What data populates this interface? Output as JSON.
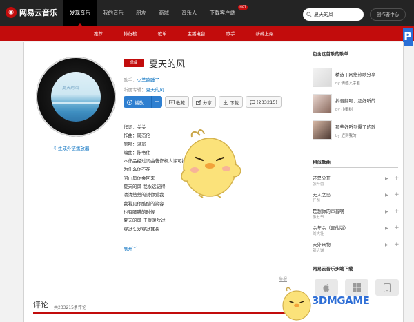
{
  "topbar": {
    "logo_text": "网易云音乐",
    "nav": [
      "发现音乐",
      "我的音乐",
      "朋友",
      "商城",
      "音乐人",
      "下载客户端"
    ],
    "hot_badge": "HOT",
    "search_value": "夏天的风",
    "creator_label": "创作者中心"
  },
  "subnav": [
    "推荐",
    "排行榜",
    "歌单",
    "主播电台",
    "歌手",
    "新碟上架"
  ],
  "song": {
    "tag": "单曲",
    "title": "夏天的风",
    "singer_label": "歌手：",
    "singer": "火羊瞌睡了",
    "album_label": "所属专辑：",
    "album": "夏天的风",
    "cover_text": "夏天的风"
  },
  "actions": {
    "play": "播放",
    "add": "+",
    "collect": "收藏",
    "share": "分享",
    "download": "下载",
    "comments": "(233215)"
  },
  "embed_link": "生成外链播放器",
  "lyrics": [
    "作词：关关",
    "作曲：周杰伦",
    "原唱：温岚",
    "编曲：陈书伟",
    "本作品经过词曲著作权人许可授权",
    "为什么你不在",
    "问山风你会回来",
    "夏天的风 我永远记得",
    "清清楚楚的说你爱我",
    "我看见你酷酷的笑容",
    "也有腼腆的时候",
    "夏天的风 正暖暖吹过",
    "穿过头发穿过耳朵"
  ],
  "expand_label": "展开",
  "report_label": "举报",
  "comments": {
    "title": "评论",
    "count": "共233215条评论"
  },
  "sidebar": {
    "playlists_header": "包含这首歌的歌单",
    "playlists": [
      {
        "name": "精选 | 网络热歌分享",
        "by_label": "by",
        "by": "情感文字君"
      },
      {
        "name": "抖音翻唱：超好听的...",
        "by_label": "by",
        "by": "小攀树"
      },
      {
        "name": "那些好听到爆了的歌",
        "by_label": "by",
        "by": "近到我的"
      }
    ],
    "similar_header": "相似歌曲",
    "similar": [
      {
        "name": "还是分开",
        "artist": "张叶蕾"
      },
      {
        "name": "无人之岛",
        "artist": "任然"
      },
      {
        "name": "是想你的声音啊",
        "artist": "傲七爷"
      },
      {
        "name": "余年余（吉他版）",
        "artist": "刘大壮"
      },
      {
        "name": "天外来物",
        "artist": "薛之谦"
      }
    ],
    "download_header": "网易云音乐多端下载"
  },
  "watermark": "3DMGAME",
  "colors": {
    "brand_red": "#c20c0c",
    "link_blue": "#0c73c2",
    "play_blue": "#2e7fd0",
    "topbar": "#242424"
  }
}
